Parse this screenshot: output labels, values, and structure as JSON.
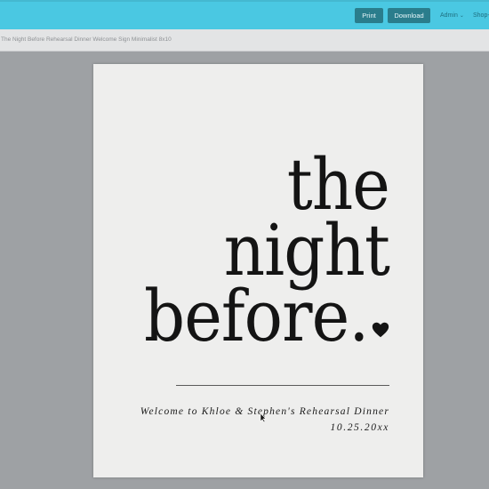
{
  "toolbar": {
    "print_label": "Print",
    "download_label": "Download",
    "admin_label": "Admin",
    "shop_label": "Shop"
  },
  "document": {
    "title": "The Night Before Rehearsal Dinner Welcome Sign Minimalist 8x10"
  },
  "sign": {
    "line1": "the",
    "line2": "night",
    "line3": "before.",
    "welcome": "Welcome to Khloe & Stephen's Rehearsal Dinner",
    "date": "10.25.20xx",
    "heart_icon": "heart-icon"
  },
  "colors": {
    "topbar": "#4ac8e2",
    "button": "#2a7d8c",
    "page": "#eeeeed",
    "ink": "#141414"
  }
}
